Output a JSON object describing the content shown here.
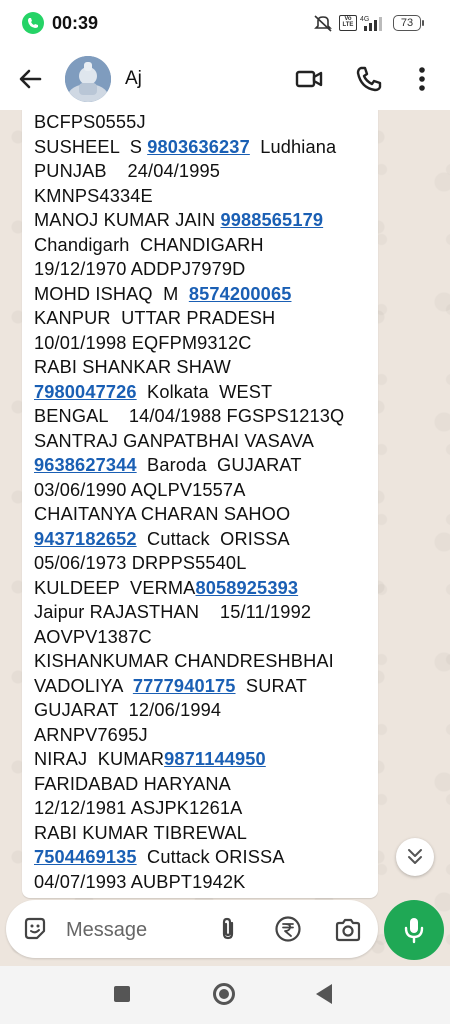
{
  "status_bar": {
    "time": "00:39",
    "network": "4G",
    "volte": "Vo LTE",
    "battery": "73",
    "icons": [
      "whatsapp-icon",
      "mute-icon",
      "volte-icon",
      "signal-icon",
      "battery-icon"
    ]
  },
  "header": {
    "contact_name": "Aj",
    "icons": [
      "back-arrow-icon",
      "avatar",
      "video-call-icon",
      "phone-icon",
      "more-vert-icon"
    ]
  },
  "message": {
    "lines": [
      [
        {
          "t": "BCFPS0555J"
        }
      ],
      [
        {
          "t": "SUSHEEL  S "
        },
        {
          "t": "9803636237",
          "link": true
        },
        {
          "t": "  Ludhiana"
        }
      ],
      [
        {
          "t": "PUNJAB    24/04/1995"
        }
      ],
      [
        {
          "t": "KMNPS4334E"
        }
      ],
      [
        {
          "t": "MANOJ KUMAR JAIN "
        },
        {
          "t": "9988565179",
          "link": true
        }
      ],
      [
        {
          "t": "Chandigarh  CHANDIGARH"
        }
      ],
      [
        {
          "t": "19/12/1970 ADDPJ7979D"
        }
      ],
      [
        {
          "t": "MOHD ISHAQ  M  "
        },
        {
          "t": "8574200065",
          "link": true
        }
      ],
      [
        {
          "t": "KANPUR  UTTAR PRADESH"
        }
      ],
      [
        {
          "t": "10/01/1998 EQFPM9312C"
        }
      ],
      [
        {
          "t": "RABI SHANKAR SHAW"
        }
      ],
      [
        {
          "t": "7980047726",
          "link": true
        },
        {
          "t": "  Kolkata  WEST"
        }
      ],
      [
        {
          "t": "BENGAL    14/04/1988 FGSPS1213Q"
        }
      ],
      [
        {
          "t": "SANTRAJ GANPATBHAI VASAVA"
        }
      ],
      [
        {
          "t": "9638627344",
          "link": true
        },
        {
          "t": "  Baroda  GUJARAT"
        }
      ],
      [
        {
          "t": "03/06/1990 AQLPV1557A"
        }
      ],
      [
        {
          "t": "CHAITANYA CHARAN SAHOO"
        }
      ],
      [
        {
          "t": "9437182652",
          "link": true
        },
        {
          "t": "  Cuttack  ORISSA"
        }
      ],
      [
        {
          "t": "05/06/1973 DRPPS5540L"
        }
      ],
      [
        {
          "t": "KULDEEP  VERMA"
        },
        {
          "t": "8058925393",
          "link": true
        }
      ],
      [
        {
          "t": "Jaipur RAJASTHAN    15/11/1992"
        }
      ],
      [
        {
          "t": "AOVPV1387C"
        }
      ],
      [
        {
          "t": "KISHANKUMAR CHANDRESHBHAI"
        }
      ],
      [
        {
          "t": "VADOLIYA  "
        },
        {
          "t": "7777940175",
          "link": true
        },
        {
          "t": "  SURAT"
        }
      ],
      [
        {
          "t": "GUJARAT  12/06/1994"
        }
      ],
      [
        {
          "t": "ARNPV7695J"
        }
      ],
      [
        {
          "t": "NIRAJ  KUMAR"
        },
        {
          "t": "9871144950",
          "link": true
        }
      ],
      [
        {
          "t": "FARIDABAD HARYANA"
        }
      ],
      [
        {
          "t": "12/12/1981 ASJPK1261A"
        }
      ],
      [
        {
          "t": "RABI KUMAR TIBREWAL"
        }
      ],
      [
        {
          "t": "7504469135",
          "link": true
        },
        {
          "t": "  Cuttack ORISSA"
        }
      ],
      [
        {
          "t": "04/07/1993 AUBPT1942K"
        }
      ]
    ]
  },
  "composer": {
    "placeholder": "Message",
    "icons": [
      "emoji-icon",
      "paperclip-icon",
      "rupee-icon",
      "camera-icon",
      "mic-icon"
    ]
  },
  "scroll_down": {
    "icon": "double-chevron-down-icon"
  },
  "nav_bar": {
    "icons": [
      "recents-icon",
      "home-icon",
      "back-icon"
    ]
  },
  "colors": {
    "brand_green": "#1fa855",
    "link_blue": "#1a5fb4",
    "chat_background": "#ede5dd"
  }
}
